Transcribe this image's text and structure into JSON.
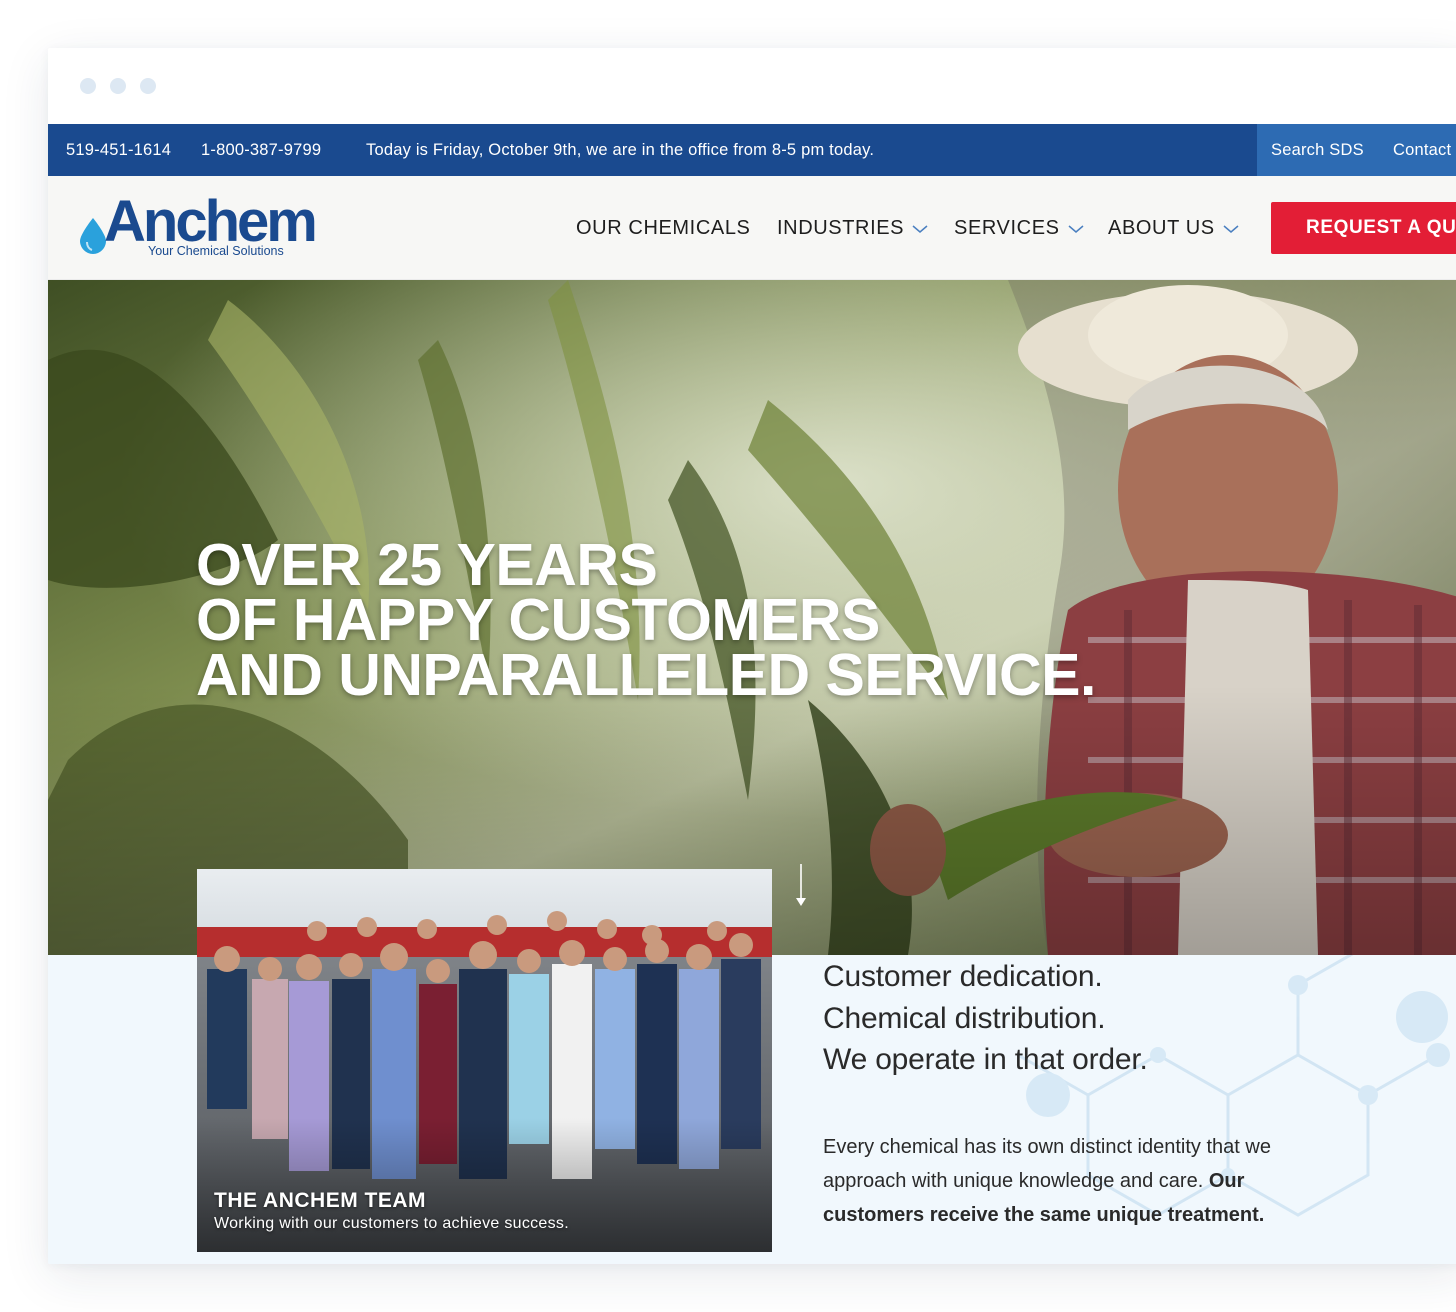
{
  "topbar": {
    "phone_local": "519-451-1614",
    "phone_toll_free": "1-800-387-9799",
    "office_notice": "Today is Friday, October 9th, we are in the office from 8-5 pm today.",
    "search_sds": "Search SDS",
    "contact": "Contact"
  },
  "logo": {
    "wordmark": "Anchem",
    "tagline": "Your Chemical Solutions"
  },
  "nav": {
    "items": [
      {
        "label": "OUR CHEMICALS",
        "has_dropdown": false
      },
      {
        "label": "INDUSTRIES",
        "has_dropdown": true
      },
      {
        "label": "SERVICES",
        "has_dropdown": true
      },
      {
        "label": "ABOUT US",
        "has_dropdown": true
      }
    ],
    "cta": "REQUEST A QU"
  },
  "hero": {
    "headline_line1": "OVER 25 YEARS",
    "headline_line2": "OF HAPPY CUSTOMERS",
    "headline_line3": "AND UNPARALLELED SERVICE.",
    "scroll_icon": "arrow-down-icon"
  },
  "team": {
    "title": "THE ANCHEM TEAM",
    "subtitle": "Working with our customers to achieve success."
  },
  "about": {
    "tagline_line1": "Customer dedication.",
    "tagline_line2": "Chemical distribution.",
    "tagline_line3": "We operate in that order.",
    "body_regular": "Every chemical has its own distinct identity that we approach with unique knowledge and care. ",
    "body_bold": "Our customers receive the same unique treatment."
  },
  "colors": {
    "brand_blue": "#1a4a8f",
    "secondary_blue": "#2d6bb3",
    "cta_red": "#e31e36",
    "section_bg": "#f1f8fd",
    "logo_drop": "#2aa1dc"
  }
}
